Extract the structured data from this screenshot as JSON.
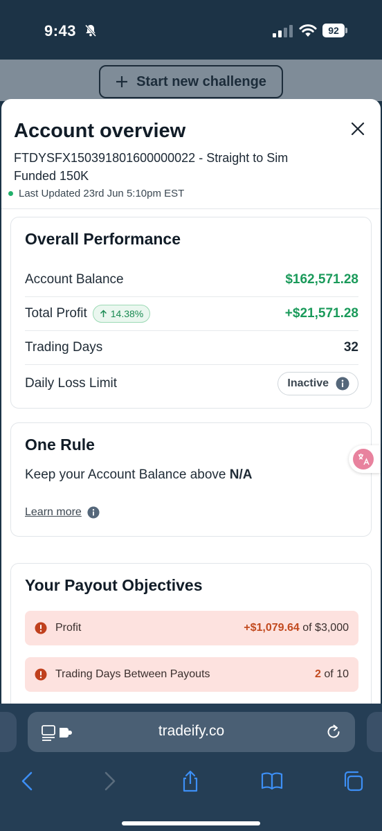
{
  "status_bar": {
    "time": "9:43",
    "battery": "92"
  },
  "background_page": {
    "start_button_label": "Start new challenge"
  },
  "modal": {
    "title": "Account overview",
    "account_id": "FTDYSFX150391801600000022 - Straight to Sim Funded 150K",
    "last_updated": "Last Updated 23rd Jun 5:10pm EST"
  },
  "performance": {
    "title": "Overall Performance",
    "rows": [
      {
        "label": "Account Balance",
        "value": "$162,571.28"
      },
      {
        "label": "Total Profit",
        "badge": "14.38%",
        "value": "+$21,571.28"
      },
      {
        "label": "Trading Days",
        "value": "32"
      },
      {
        "label": "Daily Loss Limit",
        "value": "Inactive"
      }
    ]
  },
  "one_rule": {
    "title": "One Rule",
    "text_prefix": "Keep your Account Balance above",
    "text_value": "N/A",
    "learn_more": "Learn more"
  },
  "payout_objectives": {
    "title": "Your Payout Objectives",
    "items": [
      {
        "label": "Profit",
        "current": "+$1,079.64",
        "target": "of $3,000"
      },
      {
        "label": "Trading Days Between Payouts",
        "current": "2",
        "target": "of 10"
      }
    ]
  },
  "safari": {
    "url": "tradeify.co"
  },
  "colors": {
    "positive": "#1a9a5a",
    "alert_bg": "#fde2df",
    "alert_value": "#c24a1f",
    "header_bg": "#1c3346"
  }
}
